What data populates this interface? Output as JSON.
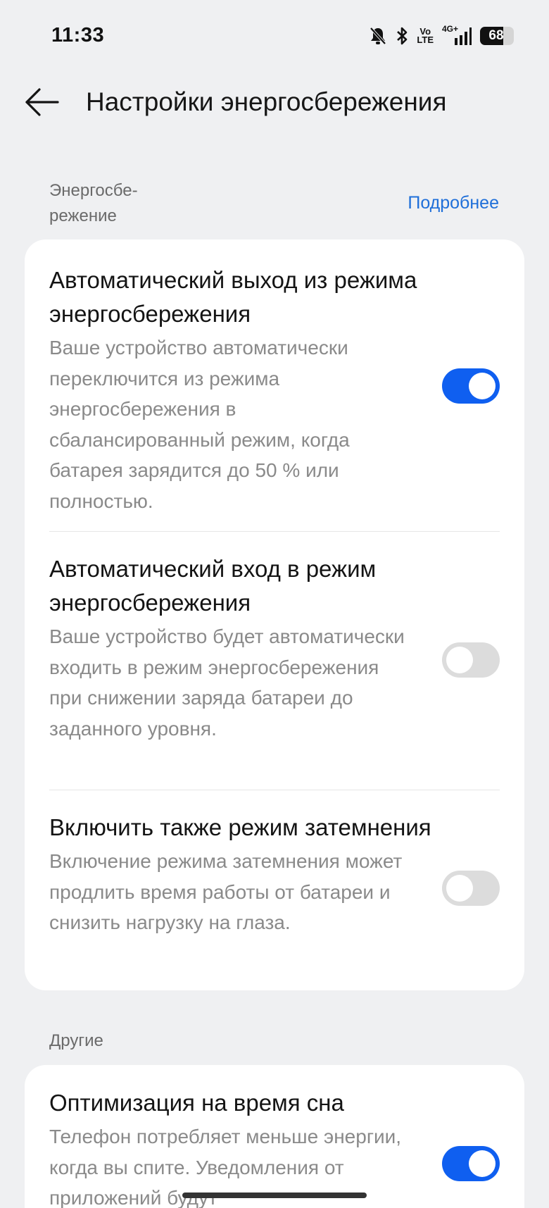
{
  "status_bar": {
    "time": "11:33",
    "icons": [
      "bell-off-icon",
      "bluetooth-icon",
      "volte-icon",
      "4g-signal-icon",
      "battery-icon"
    ],
    "volte_top": "Vo",
    "volte_bottom": "LTE",
    "network": "4G+",
    "battery_level": "68",
    "battery_fraction": 0.68
  },
  "header": {
    "back_icon": "arrow-left-icon",
    "title": "Настройки энергосбережения"
  },
  "section_power": {
    "label": "Энергосбе-\nрежение",
    "link": "Подробнее"
  },
  "power_settings": [
    {
      "title": "Автоматический выход из режима энергосбережения",
      "description": "Ваше устройство автоматически переключится из режима энергосбережения в сбалансированный режим, когда батарея зарядится до 50 % или полностью.",
      "enabled": true
    },
    {
      "title": "Автоматический вход в режим энергосбережения",
      "description": "Ваше устройство будет автоматически входить в режим энергосбережения при снижении заряда батареи до заданного уровня.",
      "enabled": false
    },
    {
      "title": "Включить также режим затемнения",
      "description": "Включение режима затемнения может продлить время работы от батареи и снизить нагрузку на глаза.",
      "enabled": false
    }
  ],
  "section_other": {
    "label": "Другие"
  },
  "other_settings": [
    {
      "title": "Оптимизация на время сна",
      "description": "Телефон потребляет меньше энергии, когда вы спите. Уведомления от приложений будут",
      "enabled": true
    }
  ],
  "colors": {
    "accent": "#0f5ff0",
    "link": "#1f6fd9",
    "background": "#eff0f2",
    "card": "#ffffff",
    "toggle_off": "#dcdcdc"
  }
}
